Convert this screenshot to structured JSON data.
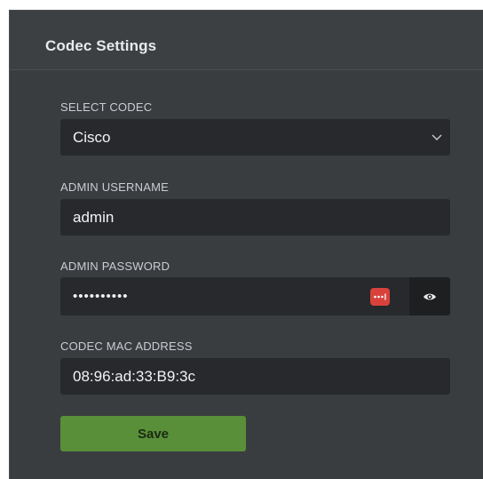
{
  "panel": {
    "title": "Codec Settings"
  },
  "fields": {
    "codec": {
      "label": "SELECT CODEC",
      "value": "Cisco"
    },
    "username": {
      "label": "ADMIN USERNAME",
      "value": "admin"
    },
    "password": {
      "label": "ADMIN PASSWORD",
      "masked_value": "••••••••••"
    },
    "mac": {
      "label": "CODEC MAC ADDRESS",
      "value": "08:96:ad:33:B9:3c"
    }
  },
  "actions": {
    "save_label": "Save"
  },
  "icons": {
    "select": "chevron-down-icon",
    "password_manager": "password-manager-icon",
    "toggle_visibility": "eye-icon"
  },
  "colors": {
    "panel_bg": "#3a3d40",
    "input_bg": "#27292c",
    "save_button": "#5a8f3a",
    "password_manager": "#d9423b"
  }
}
